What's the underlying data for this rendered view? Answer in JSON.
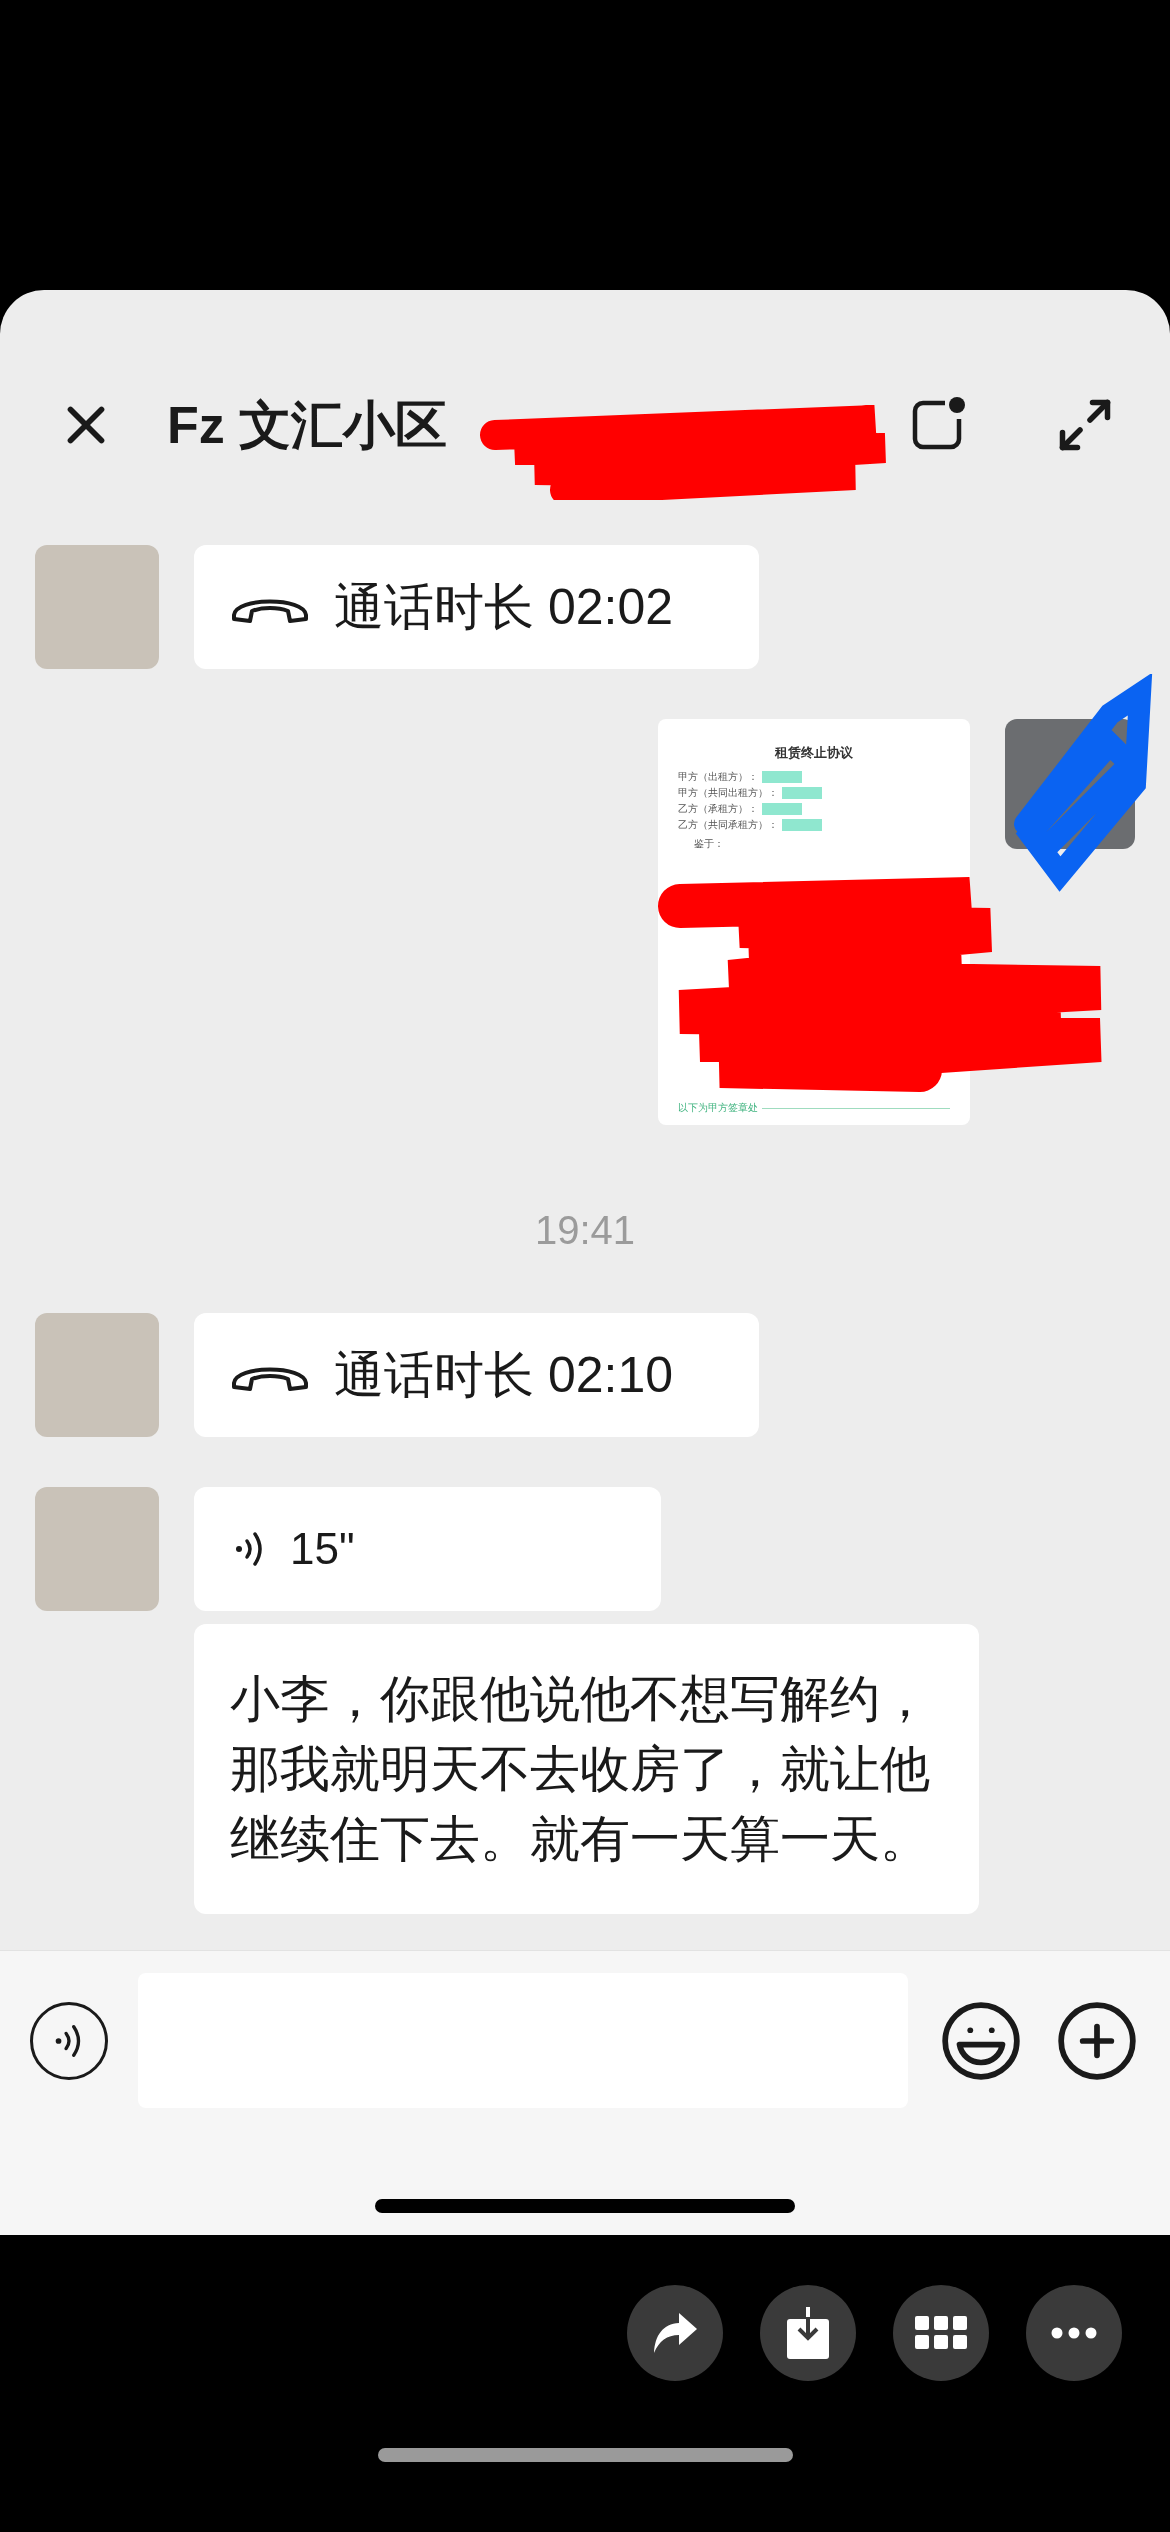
{
  "header": {
    "title": "Fz 文汇小区"
  },
  "messages": [
    {
      "kind": "call",
      "text": "通话时长 02:02"
    },
    {
      "kind": "document",
      "title": "租赁终止协议",
      "fields": [
        "甲方（出租方）：",
        "甲方（共同出租方）：",
        "乙方（承租方）：",
        "乙方（共同承租方）："
      ],
      "intro": "鉴于：",
      "footer": "以下为甲方签章处"
    },
    {
      "kind": "time",
      "text": "19:41"
    },
    {
      "kind": "call",
      "text": "通话时长 02:10"
    },
    {
      "kind": "voice",
      "text": "15\""
    },
    {
      "kind": "text",
      "text": "小李，你跟他说他不想写解约，那我就明天不去收房了，就让他继续住下去。就有一天算一天。"
    }
  ]
}
